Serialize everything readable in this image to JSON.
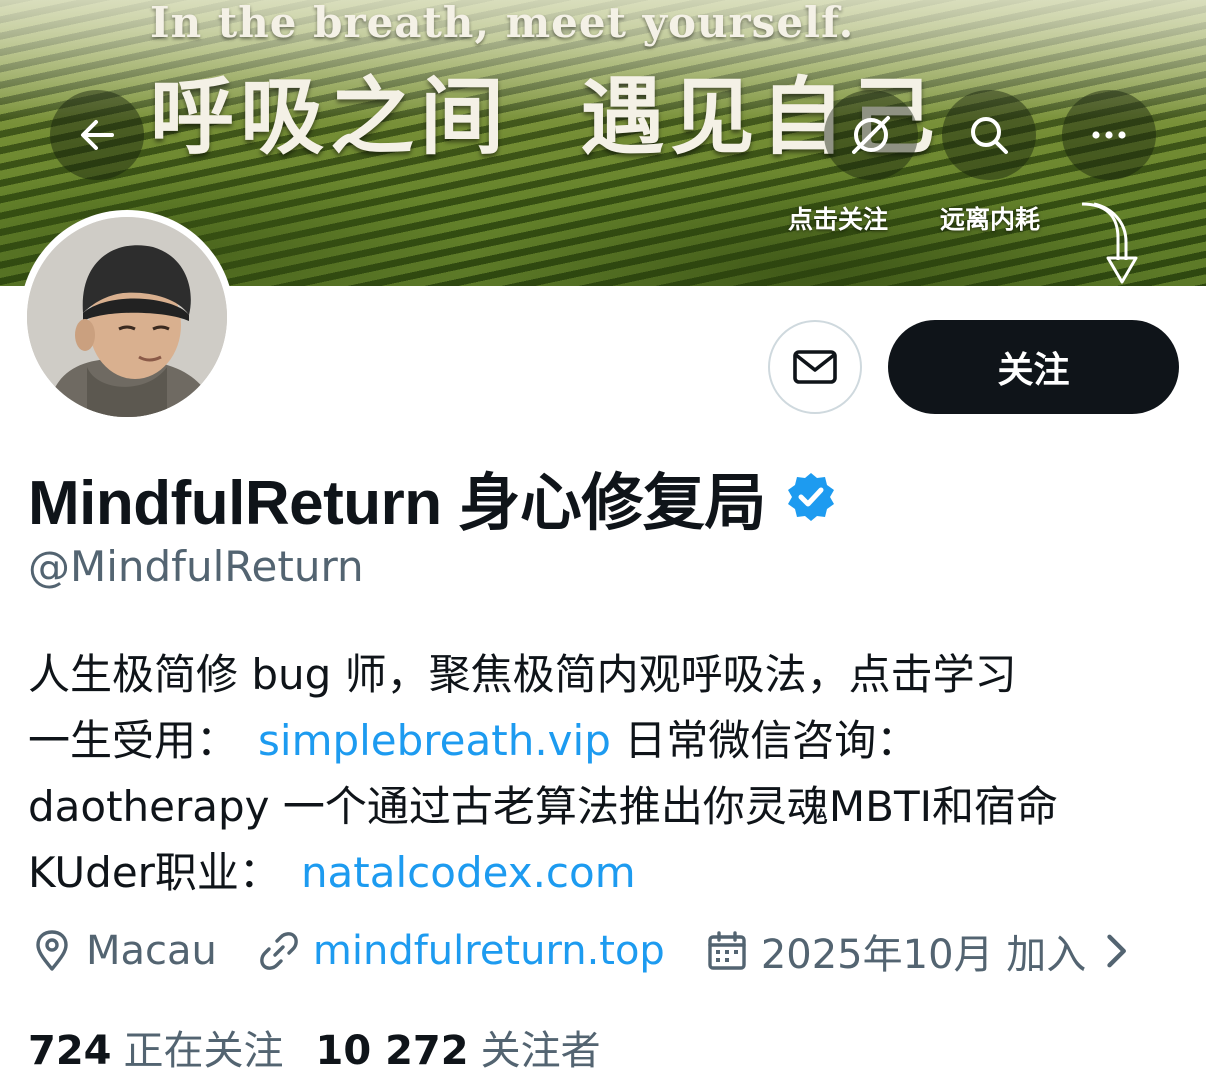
{
  "banner": {
    "title_en": "In the breath, meet yourself.",
    "title_zh": "呼吸之间  遇见自己",
    "tag_1": "点击关注",
    "tag_2": "远离内耗"
  },
  "nav": {
    "back_icon": "arrow-left-icon",
    "nav_icon": "compass-icon",
    "search_icon": "search-icon",
    "more_icon": "more-icon"
  },
  "profile": {
    "display_name": "MindfulReturn 身心修复局",
    "handle": "@MindfulReturn",
    "verified": true,
    "follow_label": "关注",
    "message_icon": "envelope-icon",
    "bio": {
      "line1": "人生极简修 bug 师，聚焦极简内观呼吸法，点击学习",
      "line2_text": "一生受用：",
      "line2_link": "simplebreath.vip",
      "line2_after": " 日常微信咨询：",
      "line3": "daotherapy 一个通过古老算法推出你灵魂MBTI和宿命",
      "line4_text": "KUder职业：",
      "line4_link": "natalcodex.com"
    },
    "location": "Macau",
    "website": "mindfulreturn.top",
    "joined": "2025年10月 加入",
    "following_count": "724",
    "following_label": "正在关注",
    "followers_count": "10 272",
    "followers_label": "关注者"
  },
  "colors": {
    "link": "#1d9bf0",
    "verified": "#1d9bf0",
    "text_primary": "#0f1419",
    "text_secondary": "#536471",
    "follow_button": "#0f1419"
  }
}
